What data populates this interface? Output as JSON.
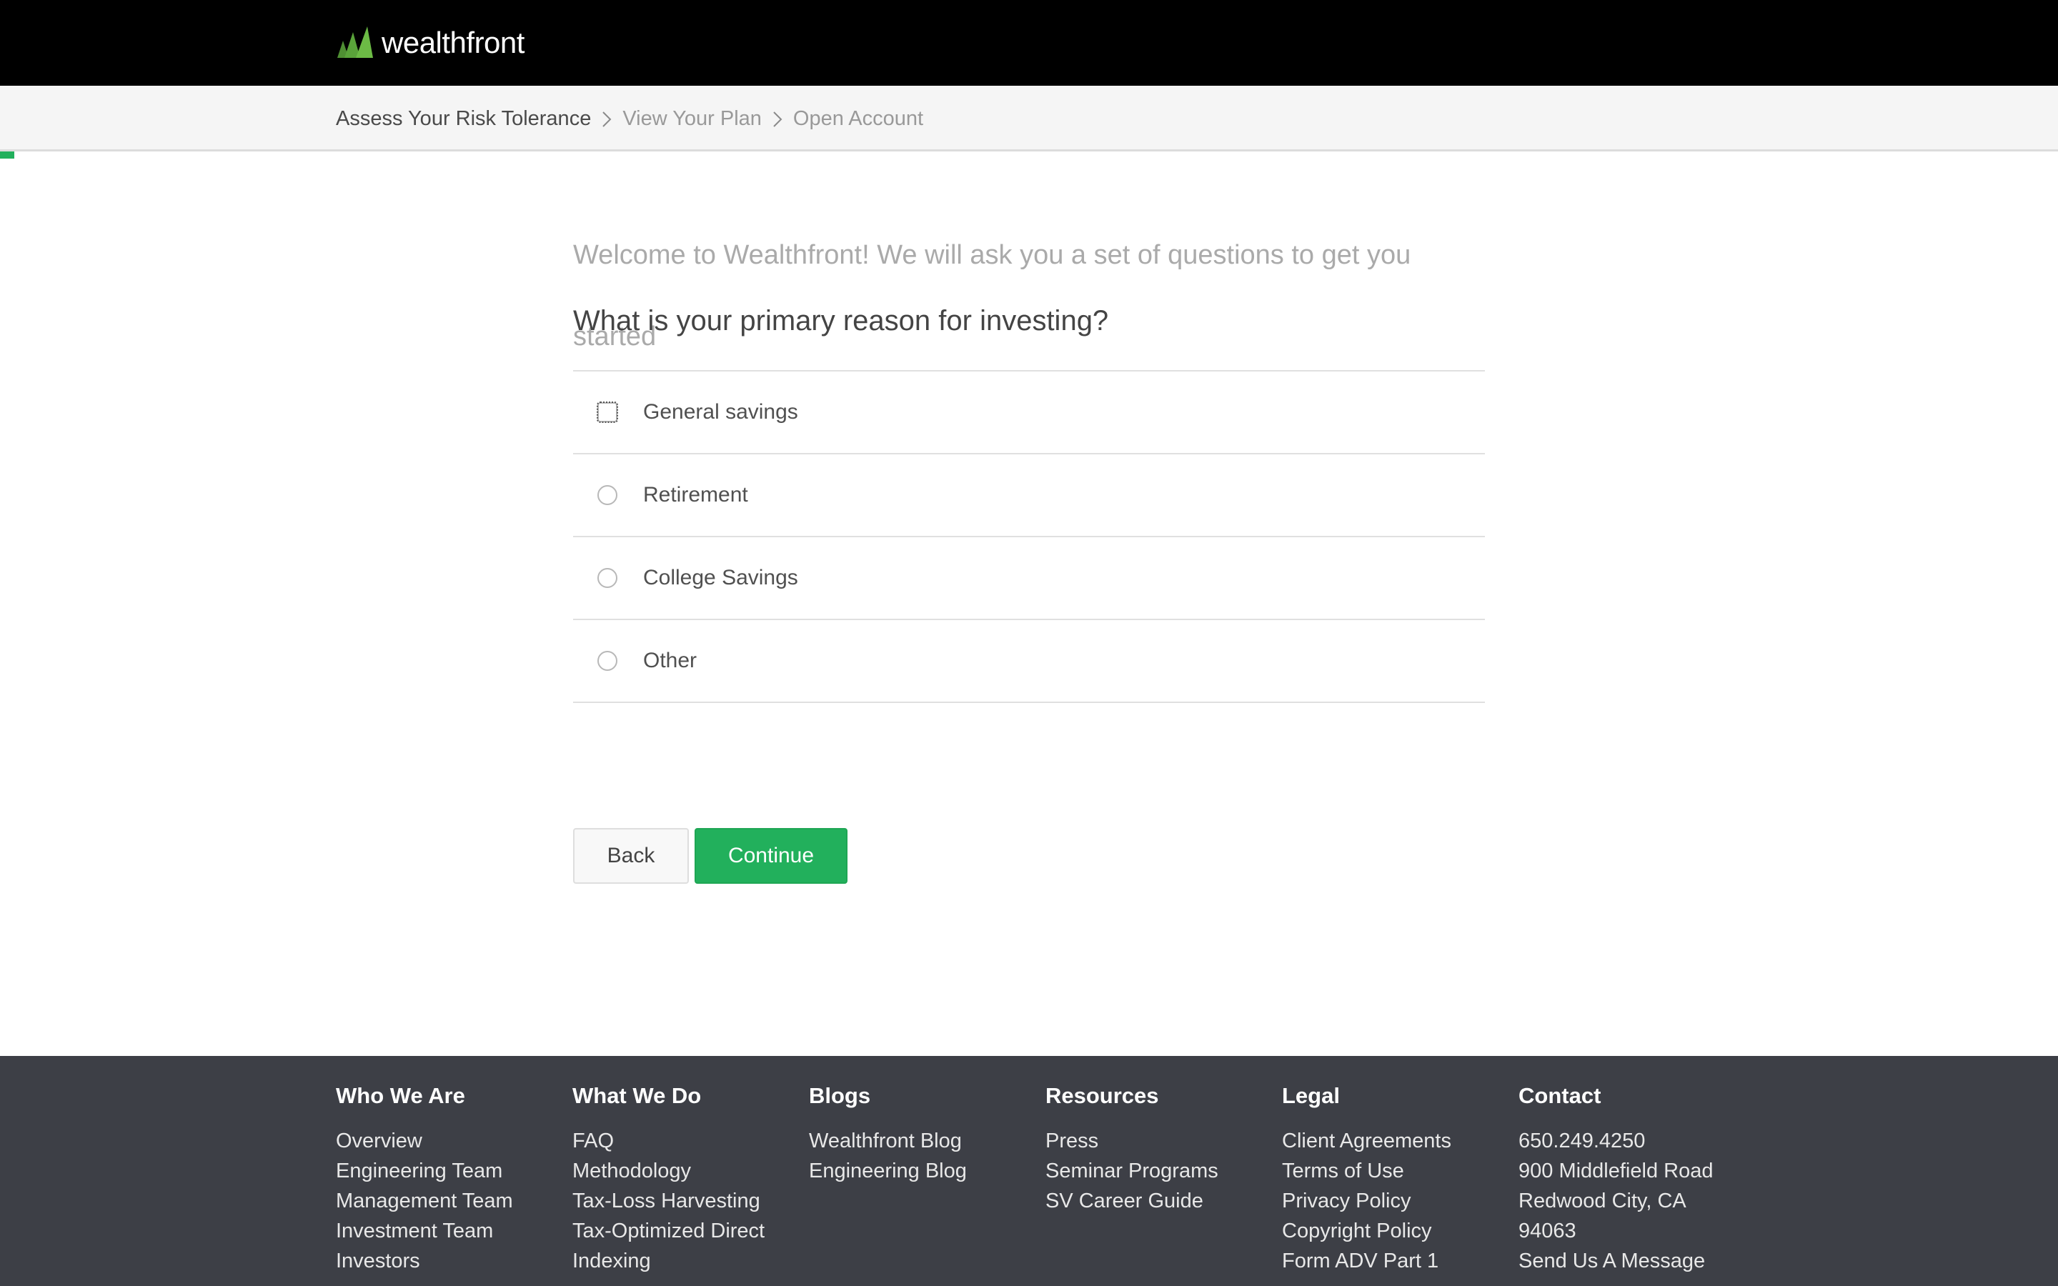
{
  "header": {
    "logo_text": "wealthfront",
    "logo_icon": "wealthfront-logo-icon",
    "colors": {
      "bar": "#000000",
      "logo_green": "#5aa33a"
    }
  },
  "breadcrumb": {
    "items": [
      {
        "label": "Assess Your Risk Tolerance",
        "active": true
      },
      {
        "label": "View Your Plan",
        "active": false
      },
      {
        "label": "Open Account",
        "active": false
      }
    ],
    "separator_icon": "chevron-right-icon"
  },
  "progress": {
    "value_fraction": 0.007,
    "color": "#22b05c"
  },
  "survey": {
    "intro": "Welcome to Wealthfront! We will ask you a set of questions to get you started",
    "question": "What is your primary reason for investing?",
    "options": [
      {
        "label": "General savings",
        "selected": false,
        "focused": true
      },
      {
        "label": "Retirement",
        "selected": false,
        "focused": false
      },
      {
        "label": "College Savings",
        "selected": false,
        "focused": false
      },
      {
        "label": "Other",
        "selected": false,
        "focused": false
      }
    ]
  },
  "actions": {
    "back_label": "Back",
    "continue_label": "Continue",
    "continue_color": "#22b05c"
  },
  "footer": {
    "columns": [
      {
        "heading": "Who We Are",
        "links": [
          "Overview",
          "Engineering Team",
          "Management Team",
          "Investment Team",
          "Investors"
        ]
      },
      {
        "heading": "What We Do",
        "links": [
          "FAQ",
          "Methodology",
          "Tax-Loss Harvesting",
          "Tax-Optimized Direct",
          "Indexing"
        ]
      },
      {
        "heading": "Blogs",
        "links": [
          "Wealthfront Blog",
          "Engineering Blog"
        ]
      },
      {
        "heading": "Resources",
        "links": [
          "Press",
          "Seminar Programs",
          "SV Career Guide"
        ]
      },
      {
        "heading": "Legal",
        "links": [
          "Client Agreements",
          "Terms of Use",
          "Privacy Policy",
          "Copyright Policy",
          "Form ADV Part 1"
        ]
      },
      {
        "heading": "Contact",
        "phone": "650.249.4250",
        "address_line1": "900 Middlefield Road",
        "address_line2": "Redwood City, CA",
        "address_line3": "94063",
        "message_link": "Send Us A Message"
      }
    ]
  }
}
